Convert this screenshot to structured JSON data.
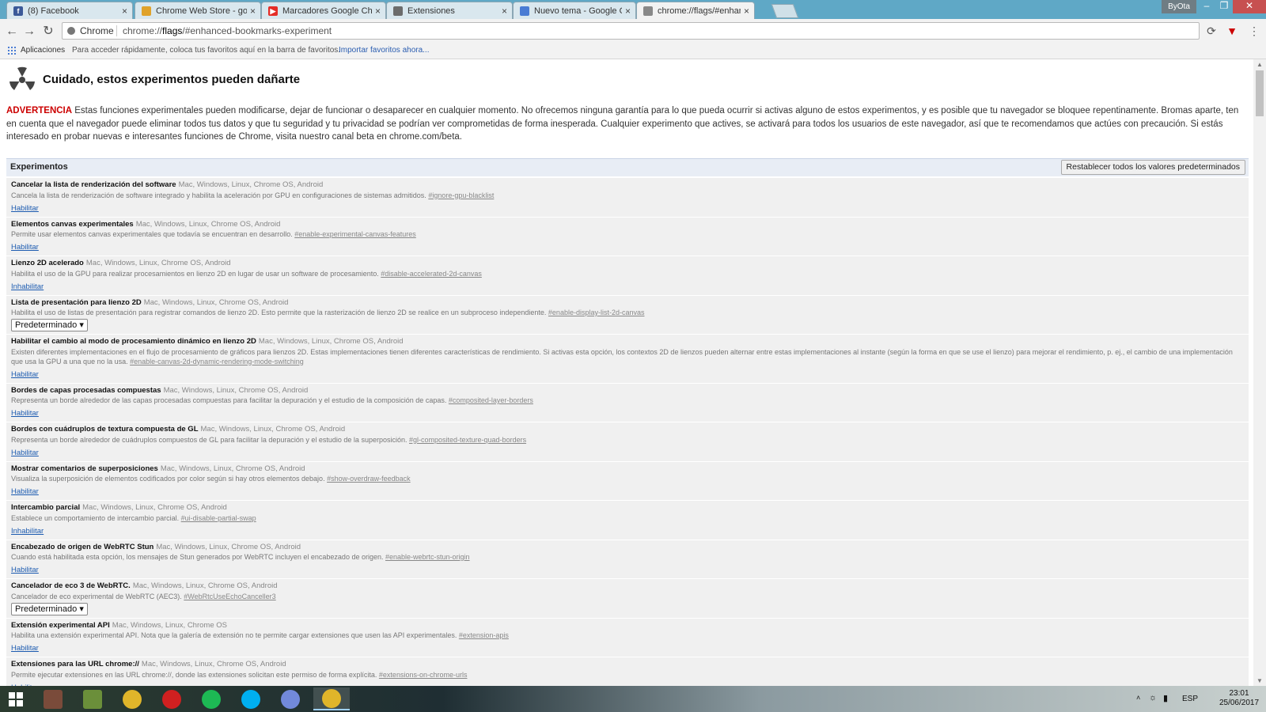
{
  "tabs": [
    {
      "label": "(8) Facebook",
      "icon": "facebook-icon",
      "color": "#3b5998",
      "glyph": "f"
    },
    {
      "label": "Chrome Web Store - goo",
      "icon": "webstore-icon",
      "color": "#e0a22a",
      "glyph": ""
    },
    {
      "label": "Marcadores Google Chro",
      "icon": "youtube-icon",
      "color": "#e52d27",
      "glyph": "▶"
    },
    {
      "label": "Extensiones",
      "icon": "puzzle-icon",
      "color": "#6c6c6c",
      "glyph": ""
    },
    {
      "label": "Nuevo tema - Google Ch",
      "icon": "forum-icon",
      "color": "#4a7cd4",
      "glyph": ""
    },
    {
      "label": "chrome://flags/#enhance",
      "icon": "chrome-page-icon",
      "color": "#888888",
      "glyph": ""
    }
  ],
  "window": {
    "user": "ByOta",
    "minimize": "–",
    "maximize": "❐",
    "close": "✕"
  },
  "toolbar": {
    "chip": "Chrome",
    "url_prefix": "chrome://",
    "url_host": "flags",
    "url_rest": "/#enhanced-bookmarks-experiment"
  },
  "bookmarks": {
    "apps": "Aplicaciones",
    "hint": "Para acceder rápidamente, coloca tus favoritos aquí en la barra de favoritos.",
    "import": "Importar favoritos ahora..."
  },
  "page": {
    "title": "Cuidado, estos experimentos pueden dañarte",
    "warning_label": "ADVERTENCIA",
    "warning_text": " Estas funciones experimentales pueden modificarse, dejar de funcionar o desaparecer en cualquier momento. No ofrecemos ninguna garantía para lo que pueda ocurrir si activas alguno de estos experimentos, y es posible que tu navegador se bloquee repentinamente. Bromas aparte, ten en cuenta que el navegador puede eliminar todos tus datos y que tu seguridad y tu privacidad se podrían ver comprometidas de forma inesperada. Cualquier experimento que actives, se activará para todos los usuarios de este navegador, así que te recomendamos que actúes con precaución. Si estás interesado en probar nuevas e interesantes funciones de Chrome, visita nuestro canal beta en chrome.com/beta.",
    "experiments_title": "Experimentos",
    "reset_button": "Restablecer todos los valores predeterminados"
  },
  "experiments": [
    {
      "name": "Cancelar la lista de renderización del software",
      "platforms": "Mac, Windows, Linux, Chrome OS, Android",
      "desc": "Cancela la lista de renderización de software integrado y habilita la aceleración por GPU en configuraciones de sistemas admitidos.",
      "hash": "#ignore-gpu-blacklist",
      "action": "Habilitar",
      "type": "link"
    },
    {
      "name": "Elementos canvas experimentales",
      "platforms": "Mac, Windows, Linux, Chrome OS, Android",
      "desc": "Permite usar elementos canvas experimentales que todavía se encuentran en desarrollo.",
      "hash": "#enable-experimental-canvas-features",
      "action": "Habilitar",
      "type": "link"
    },
    {
      "name": "Lienzo 2D acelerado",
      "platforms": "Mac, Windows, Linux, Chrome OS, Android",
      "desc": "Habilita el uso de la GPU para realizar procesamientos en lienzo 2D en lugar de usar un software de procesamiento.",
      "hash": "#disable-accelerated-2d-canvas",
      "action": "Inhabilitar",
      "type": "link"
    },
    {
      "name": "Lista de presentación para lienzo 2D",
      "platforms": "Mac, Windows, Linux, Chrome OS, Android",
      "desc": "Habilita el uso de listas de presentación para registrar comandos de lienzo 2D. Esto permite que la rasterización de lienzo 2D se realice en un subproceso independiente.",
      "hash": "#enable-display-list-2d-canvas",
      "action": "Predeterminado",
      "type": "select"
    },
    {
      "name": "Habilitar el cambio al modo de procesamiento dinámico en lienzo 2D",
      "platforms": "Mac, Windows, Linux, Chrome OS, Android",
      "desc": "Existen diferentes implementaciones en el flujo de procesamiento de gráficos para lienzos 2D. Estas implementaciones tienen diferentes características de rendimiento. Si activas esta opción, los contextos 2D de lienzos pueden alternar entre estas implementaciones al instante (según la forma en que se use el lienzo) para mejorar el rendimiento, p. ej., el cambio de una implementación que usa la GPU a una que no la usa.",
      "hash": "#enable-canvas-2d-dynamic-rendering-mode-switching",
      "action": "Habilitar",
      "type": "link"
    },
    {
      "name": "Bordes de capas procesadas compuestas",
      "platforms": "Mac, Windows, Linux, Chrome OS, Android",
      "desc": "Representa un borde alrededor de las capas procesadas compuestas para facilitar la depuración y el estudio de la composición de capas.",
      "hash": "#composited-layer-borders",
      "action": "Habilitar",
      "type": "link"
    },
    {
      "name": "Bordes con cuádruplos de textura compuesta de GL",
      "platforms": "Mac, Windows, Linux, Chrome OS, Android",
      "desc": "Representa un borde alrededor de cuádruplos compuestos de GL para facilitar la depuración y el estudio de la superposición.",
      "hash": "#gl-composited-texture-quad-borders",
      "action": "Habilitar",
      "type": "link"
    },
    {
      "name": "Mostrar comentarios de superposiciones",
      "platforms": "Mac, Windows, Linux, Chrome OS, Android",
      "desc": "Visualiza la superposición de elementos codificados por color según si hay otros elementos debajo.",
      "hash": "#show-overdraw-feedback",
      "action": "Habilitar",
      "type": "link"
    },
    {
      "name": "Intercambio parcial",
      "platforms": "Mac, Windows, Linux, Chrome OS, Android",
      "desc": "Establece un comportamiento de intercambio parcial.",
      "hash": "#ui-disable-partial-swap",
      "action": "Inhabilitar",
      "type": "link"
    },
    {
      "name": "Encabezado de origen de WebRTC Stun",
      "platforms": "Mac, Windows, Linux, Chrome OS, Android",
      "desc": "Cuando está habilitada esta opción, los mensajes de Stun generados por WebRTC incluyen el encabezado de origen.",
      "hash": "#enable-webrtc-stun-origin",
      "action": "Habilitar",
      "type": "link"
    },
    {
      "name": "Cancelador de eco 3 de WebRTC.",
      "platforms": "Mac, Windows, Linux, Chrome OS, Android",
      "desc": "Cancelador de eco experimental de WebRTC (AEC3).",
      "hash": "#WebRtcUseEchoCanceller3",
      "action": "Predeterminado",
      "type": "select"
    },
    {
      "name": "Extensión experimental API",
      "platforms": "Mac, Windows, Linux, Chrome OS",
      "desc": "Habilita una extensión experimental API. Nota que la galería de extensión no te permite cargar extensiones que usen las API experimentales.",
      "hash": "#extension-apis",
      "action": "Habilitar",
      "type": "link"
    },
    {
      "name": "Extensiones para las URL chrome://",
      "platforms": "Mac, Windows, Linux, Chrome OS, Android",
      "desc": "Permite ejecutar extensiones en las URL chrome://, donde las extensiones solicitan este permiso de forma explícita.",
      "hash": "#extensions-on-chrome-urls",
      "action": "Habilitar",
      "type": "link"
    }
  ],
  "taskbar": {
    "apps": [
      {
        "name": "game-app-icon",
        "color": "#7a4b3a"
      },
      {
        "name": "minecraft-icon",
        "color": "#6b8f3a"
      },
      {
        "name": "chrome-icon",
        "color": "#e0b52a"
      },
      {
        "name": "record-icon",
        "color": "#d02020"
      },
      {
        "name": "spotify-icon",
        "color": "#1db954"
      },
      {
        "name": "skype-icon",
        "color": "#00aff0"
      },
      {
        "name": "discord-icon",
        "color": "#7289da"
      },
      {
        "name": "chrome-active-icon",
        "color": "#e0b52a"
      }
    ],
    "lang": "ESP",
    "time": "23:01",
    "date": "25/06/2017"
  }
}
